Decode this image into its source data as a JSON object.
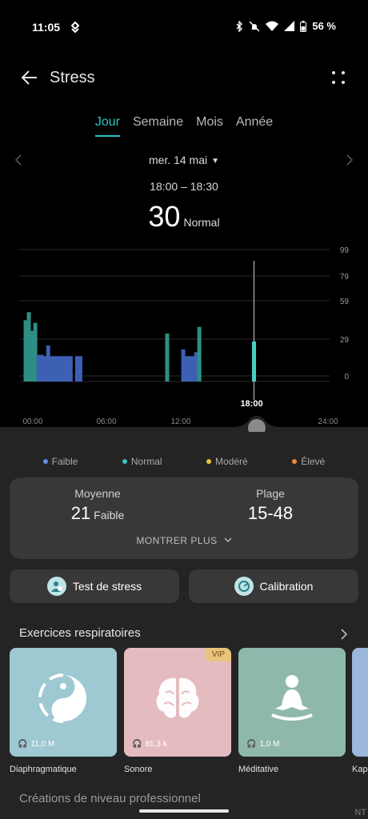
{
  "status": {
    "time": "11:05",
    "battery": "56 %"
  },
  "header": {
    "title": "Stress"
  },
  "tabs": [
    {
      "label": "Jour",
      "active": true
    },
    {
      "label": "Semaine",
      "active": false
    },
    {
      "label": "Mois",
      "active": false
    },
    {
      "label": "Année",
      "active": false
    }
  ],
  "date": {
    "label": "mer. 14 mai",
    "range": "18:00 – 18:30",
    "value": "30",
    "level": "Normal"
  },
  "chart_data": {
    "type": "bar",
    "x_ticks": [
      "00:00",
      "06:00",
      "12:00",
      "24:00"
    ],
    "selected_label": "18:00",
    "selected_x_hours": 18.25,
    "y_ticks": [
      "99",
      "79",
      "59",
      "29",
      "0"
    ],
    "y_tick_values": [
      99,
      79,
      59,
      29,
      0
    ],
    "x_range_hours": [
      0,
      24
    ],
    "bars": [
      {
        "h": 0.5,
        "v": 46,
        "lvl": "normal"
      },
      {
        "h": 0.75,
        "v": 52,
        "lvl": "normal"
      },
      {
        "h": 1.0,
        "v": 38,
        "lvl": "normal"
      },
      {
        "h": 1.25,
        "v": 44,
        "lvl": "normal"
      },
      {
        "h": 1.5,
        "v": 20,
        "lvl": "low"
      },
      {
        "h": 1.75,
        "v": 20,
        "lvl": "low"
      },
      {
        "h": 2.0,
        "v": 19,
        "lvl": "low"
      },
      {
        "h": 2.25,
        "v": 27,
        "lvl": "low"
      },
      {
        "h": 2.5,
        "v": 19,
        "lvl": "low"
      },
      {
        "h": 2.75,
        "v": 19,
        "lvl": "low"
      },
      {
        "h": 3.0,
        "v": 19,
        "lvl": "low"
      },
      {
        "h": 3.25,
        "v": 19,
        "lvl": "low"
      },
      {
        "h": 3.5,
        "v": 19,
        "lvl": "low"
      },
      {
        "h": 3.75,
        "v": 19,
        "lvl": "low"
      },
      {
        "h": 4.0,
        "v": 19,
        "lvl": "low"
      },
      {
        "h": 4.5,
        "v": 19,
        "lvl": "low"
      },
      {
        "h": 4.75,
        "v": 19,
        "lvl": "low"
      },
      {
        "h": 11.5,
        "v": 36,
        "lvl": "normal"
      },
      {
        "h": 12.75,
        "v": 24,
        "lvl": "low"
      },
      {
        "h": 13.0,
        "v": 19,
        "lvl": "low"
      },
      {
        "h": 13.25,
        "v": 19,
        "lvl": "low"
      },
      {
        "h": 13.5,
        "v": 19,
        "lvl": "low"
      },
      {
        "h": 13.75,
        "v": 22,
        "lvl": "low"
      },
      {
        "h": 14.0,
        "v": 41,
        "lvl": "normal"
      },
      {
        "h": 18.25,
        "v": 30,
        "lvl": "normal",
        "selected": true
      }
    ],
    "colors": {
      "low": "#3c60b4",
      "normal": "#2d8f84",
      "selected": "#45d0c6"
    }
  },
  "legend": [
    {
      "label": "Faible",
      "color": "#5b8ff0"
    },
    {
      "label": "Normal",
      "color": "#3ec0c0"
    },
    {
      "label": "Modéré",
      "color": "#f3c044"
    },
    {
      "label": "Élevé",
      "color": "#f0883c"
    }
  ],
  "stats": {
    "avg_title": "Moyenne",
    "avg_value": "21",
    "avg_level": "Faible",
    "range_title": "Plage",
    "range_value": "15-48",
    "show_more": "MONTRER PLUS"
  },
  "actions": {
    "stress_test": "Test de stress",
    "calibration": "Calibration"
  },
  "exercises": {
    "title": "Exercices respiratoires",
    "cards": [
      {
        "label": "Diaphragmatique",
        "count": "11,0 M",
        "bg": "#9ec8d2",
        "vip": ""
      },
      {
        "label": "Sonore",
        "count": "81,3 k",
        "bg": "#e4bcc0",
        "vip": "VIP"
      },
      {
        "label": "Méditative",
        "count": "1,0 M",
        "bg": "#8fb8ad",
        "vip": ""
      },
      {
        "label": "Kap",
        "count": "",
        "bg": "#9cb6dc",
        "vip": ""
      }
    ]
  },
  "next_section": {
    "title": "Créations de niveau professionnel"
  },
  "watermark": "NT"
}
